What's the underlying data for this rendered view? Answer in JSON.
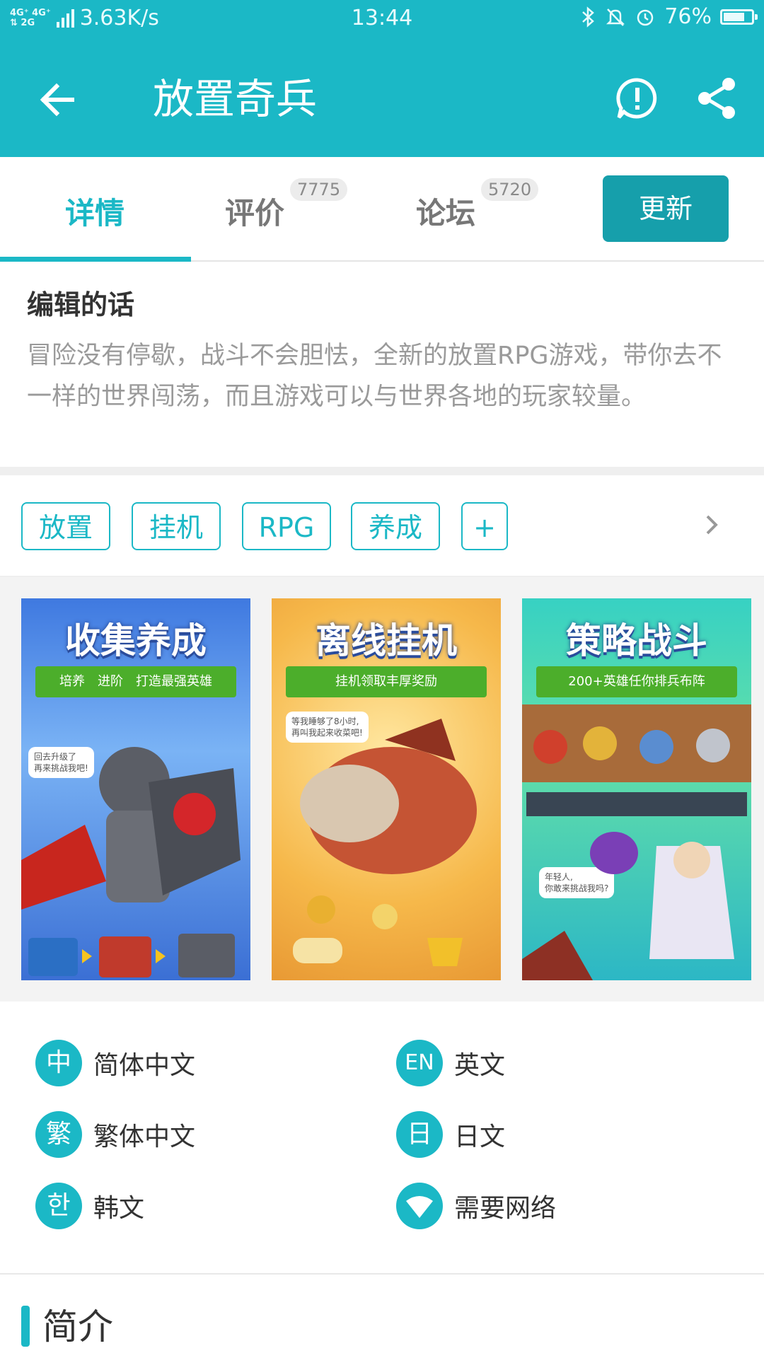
{
  "status_bar": {
    "network_top": "4G⁺ 4G⁺",
    "network_bottom": "⇅ 2G",
    "speed": "3.63K/s",
    "time": "13:44",
    "battery": "76%",
    "battery_level": 0.76
  },
  "toolbar": {
    "title": "放置奇兵"
  },
  "tabs": {
    "details": "详情",
    "reviews": "评价",
    "reviews_count": "7775",
    "forum": "论坛",
    "forum_count": "5720",
    "update": "更新"
  },
  "editor": {
    "heading": "编辑的话",
    "text": "冒险没有停歇，战斗不会胆怯，全新的放置RPG游戏，带你去不一样的世界闯荡，而且游戏可以与世界各地的玩家较量。"
  },
  "tags": [
    "放置",
    "挂机",
    "RPG",
    "养成",
    "+"
  ],
  "screenshots": [
    {
      "caption": "收集养成",
      "subtitle": "培养　进阶　打造最强英雄",
      "bubble": "回去升级了\n再来挑战我吧!"
    },
    {
      "caption": "离线挂机",
      "subtitle": "挂机领取丰厚奖励",
      "bubble": "等我睡够了8小时,\n再叫我起来收菜吧!"
    },
    {
      "caption": "策略战斗",
      "subtitle": "200+英雄任你排兵布阵",
      "bubble": "年轻人,\n你敢来挑战我吗?"
    }
  ],
  "languages": {
    "zh_s": {
      "badge": "中",
      "name": "简体中文"
    },
    "en": {
      "badge": "EN",
      "name": "英文"
    },
    "zh_t": {
      "badge": "繁",
      "name": "繁体中文"
    },
    "ja": {
      "badge": "日",
      "name": "日文"
    },
    "ko": {
      "badge": "한",
      "name": "韩文"
    },
    "net": {
      "name": "需要网络"
    }
  },
  "intro": {
    "label": "简介"
  },
  "colors": {
    "accent": "#1bb8c6",
    "update_button": "#169fab"
  }
}
